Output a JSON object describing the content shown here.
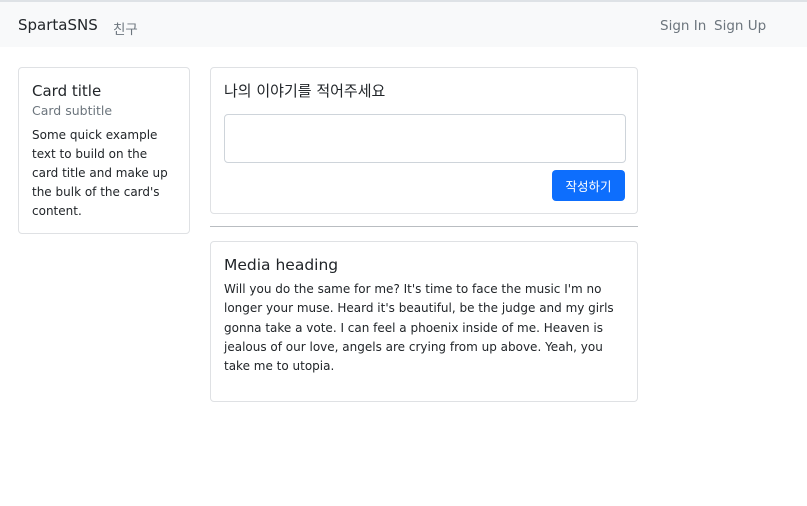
{
  "navbar": {
    "brand": "SpartaSNS",
    "friend_link": "친구",
    "sign_in": "Sign In",
    "sign_up": "Sign Up"
  },
  "side_card": {
    "title": "Card title",
    "subtitle": "Card subtitle",
    "text": "Some quick example text to build on the card title and make up the bulk of the card's content."
  },
  "post_card": {
    "prompt": "나의 이야기를 적어주세요",
    "input_value": "",
    "submit_label": "작성하기"
  },
  "media_card": {
    "heading": "Media heading",
    "body": "Will you do the same for me? It's time to face the music I'm no longer your muse. Heard it's beautiful, be the judge and my girls gonna take a vote. I can feel a phoenix inside of me. Heaven is jealous of our love, angels are crying from up above. Yeah, you take me to utopia."
  },
  "colors": {
    "navbar_bg": "#f8f9fa",
    "primary_button": "#0d6efd",
    "muted_text": "#6c757d"
  }
}
